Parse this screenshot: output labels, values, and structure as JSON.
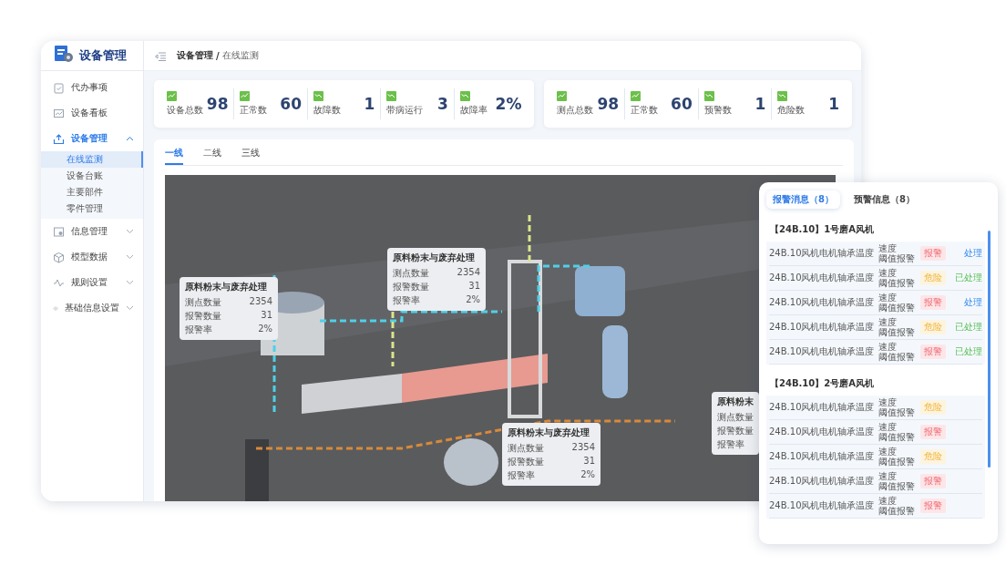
{
  "app": {
    "title": "设备管理"
  },
  "sidebar": {
    "items": [
      {
        "label": "代办事项",
        "selected": false
      },
      {
        "label": "设备看板",
        "selected": false
      },
      {
        "label": "设备管理",
        "selected": true,
        "expanded": true,
        "children": [
          {
            "label": "在线监测",
            "selected": true
          },
          {
            "label": "设备台账",
            "selected": false
          },
          {
            "label": "主要部件",
            "selected": false
          },
          {
            "label": "零件管理",
            "selected": false
          }
        ]
      },
      {
        "label": "信息管理",
        "selected": false,
        "expanded": false
      },
      {
        "label": "模型数据",
        "selected": false,
        "expanded": false
      },
      {
        "label": "规则设置",
        "selected": false,
        "expanded": false
      },
      {
        "label": "基础信息设置",
        "selected": false,
        "expanded": false
      }
    ]
  },
  "breadcrumb": {
    "items": [
      "设备管理",
      "在线监测"
    ],
    "separator": "/"
  },
  "stat_groups": [
    [
      {
        "label": "设备总数",
        "value": "98",
        "kind": "up"
      },
      {
        "label": "正常数",
        "value": "60",
        "kind": "up"
      },
      {
        "label": "故障数",
        "value": "1",
        "kind": "down"
      },
      {
        "label": "带病运行",
        "value": "3",
        "kind": "down"
      },
      {
        "label": "故障率",
        "value": "2%",
        "kind": "down"
      }
    ],
    [
      {
        "label": "测点总数",
        "value": "98",
        "kind": "up"
      },
      {
        "label": "正常数",
        "value": "60",
        "kind": "up"
      },
      {
        "label": "预警数",
        "value": "1",
        "kind": "down"
      },
      {
        "label": "危险数",
        "value": "1",
        "kind": "down"
      }
    ]
  ],
  "tabs": [
    {
      "label": "一线",
      "selected": true
    },
    {
      "label": "二线",
      "selected": false
    },
    {
      "label": "三线",
      "selected": false
    }
  ],
  "callouts": [
    {
      "title": "原料粉末与废弃处理",
      "rows": [
        {
          "label": "测点数量",
          "value": "2354"
        },
        {
          "label": "报警数量",
          "value": "31"
        },
        {
          "label": "报警率",
          "value": "2%"
        }
      ]
    },
    {
      "title": "原料粉末与废弃处理",
      "rows": [
        {
          "label": "测点数量",
          "value": "2354"
        },
        {
          "label": "报警数量",
          "value": "31"
        },
        {
          "label": "报警率",
          "value": "2%"
        }
      ]
    },
    {
      "title": "原料粉末与废弃处理",
      "rows": [
        {
          "label": "测点数量",
          "value": "2354"
        },
        {
          "label": "报警数量",
          "value": "31"
        },
        {
          "label": "报警率",
          "value": "2%"
        }
      ]
    },
    {
      "title": "原料粉末",
      "rows": [
        {
          "label": "测点数量"
        },
        {
          "label": "报警数量"
        },
        {
          "label": "报警率"
        }
      ]
    }
  ],
  "alert_panel": {
    "tabs": [
      {
        "label": "报警消息（8）",
        "selected": true
      },
      {
        "label": "预警信息（8）",
        "selected": false
      }
    ],
    "groups": [
      {
        "title": "【24B.10】1号磨A风机",
        "rows": [
          {
            "name": "24B.10风机电机轴承温度",
            "type": "速度",
            "rule": "阈值报警",
            "kind": "alarm",
            "badge": "报警",
            "action": "处理",
            "handled": false
          },
          {
            "name": "24B.10风机电机轴承温度",
            "type": "速度",
            "rule": "阈值报警",
            "kind": "danger",
            "badge": "危险",
            "action": "已处理",
            "handled": true
          },
          {
            "name": "24B.10风机电机轴承温度",
            "type": "速度",
            "rule": "阈值报警",
            "kind": "alarm",
            "badge": "报警",
            "action": "处理",
            "handled": false
          },
          {
            "name": "24B.10风机电机轴承温度",
            "type": "速度",
            "rule": "阈值报警",
            "kind": "danger",
            "badge": "危险",
            "action": "已处理",
            "handled": true
          },
          {
            "name": "24B.10风机电机轴承温度",
            "type": "速度",
            "rule": "阈值报警",
            "kind": "alarm",
            "badge": "报警",
            "action": "已处理",
            "handled": true
          }
        ]
      },
      {
        "title": "【24B.10】2号磨A风机",
        "rows": [
          {
            "name": "24B.10风机电机轴承温度",
            "type": "速度",
            "rule": "阈值报警",
            "kind": "danger",
            "badge": "危险"
          },
          {
            "name": "24B.10风机电机轴承温度",
            "type": "速度",
            "rule": "阈值报警",
            "kind": "alarm",
            "badge": "报警"
          },
          {
            "name": "24B.10风机电机轴承温度",
            "type": "速度",
            "rule": "阈值报警",
            "kind": "danger",
            "badge": "危险"
          },
          {
            "name": "24B.10风机电机轴承温度",
            "type": "速度",
            "rule": "阈值报警",
            "kind": "alarm",
            "badge": "报警"
          },
          {
            "name": "24B.10风机电机轴承温度",
            "type": "速度",
            "rule": "阈值报警",
            "kind": "alarm",
            "badge": "报警"
          }
        ]
      }
    ]
  }
}
